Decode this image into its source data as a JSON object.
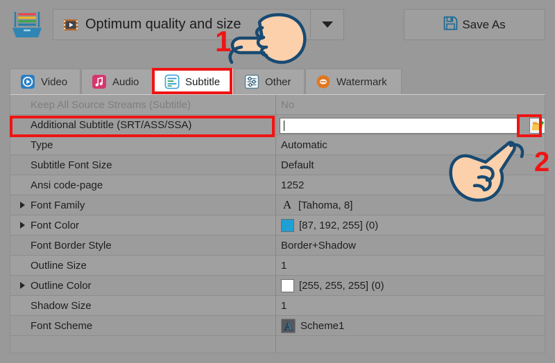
{
  "app": {
    "background_color": "#999999",
    "accent_red": "#ef1414"
  },
  "toolbar": {
    "logo_icon": "inbox-tray-icon",
    "preset": {
      "icon": "film-strip-play-icon",
      "value": "Optimum quality and size",
      "dropdown_icon": "chevron-down-icon"
    },
    "save_as": {
      "icon": "floppy-disk-save-icon",
      "label": "Save As"
    }
  },
  "tabs": [
    {
      "id": "video",
      "label": "Video",
      "icon": "video-camera-icon",
      "active": false
    },
    {
      "id": "audio",
      "label": "Audio",
      "icon": "music-note-icon",
      "active": false
    },
    {
      "id": "subtitle",
      "label": "Subtitle",
      "icon": "subtitle-lines-icon",
      "active": true
    },
    {
      "id": "other",
      "label": "Other",
      "icon": "sliders-icon",
      "active": false
    },
    {
      "id": "watermark",
      "label": "Watermark",
      "icon": "watermark-badge-icon",
      "active": false
    }
  ],
  "properties": {
    "rows": [
      {
        "name": "Keep All Source Streams (Subtitle)",
        "value": "No",
        "disabled": true,
        "expandable": false,
        "widget": "none"
      },
      {
        "name": "Additional Subtitle (SRT/ASS/SSA)",
        "value": "",
        "disabled": false,
        "expandable": false,
        "widget": "editor",
        "placeholder": ""
      },
      {
        "name": "Type",
        "value": "Automatic",
        "disabled": false,
        "expandable": false,
        "widget": "none"
      },
      {
        "name": "Subtitle Font Size",
        "value": "Default",
        "disabled": false,
        "expandable": false,
        "widget": "none"
      },
      {
        "name": "Ansi code-page",
        "value": "1252",
        "disabled": false,
        "expandable": false,
        "widget": "none"
      },
      {
        "name": "Font Family",
        "value": "[Tahoma, 8]",
        "disabled": false,
        "expandable": true,
        "widget": "font-A-icon"
      },
      {
        "name": "Font Color",
        "value": "[87, 192, 255] (0)",
        "disabled": false,
        "expandable": true,
        "widget": "swatch",
        "swatch_color": "#1f9fd4"
      },
      {
        "name": "Font Border Style",
        "value": "Border+Shadow",
        "disabled": false,
        "expandable": false,
        "widget": "none"
      },
      {
        "name": "Outline Size",
        "value": "1",
        "disabled": false,
        "expandable": false,
        "widget": "none"
      },
      {
        "name": "Outline Color",
        "value": "[255, 255, 255] (0)",
        "disabled": false,
        "expandable": true,
        "widget": "swatch",
        "swatch_color": "#ffffff"
      },
      {
        "name": "Shadow Size",
        "value": "1",
        "disabled": false,
        "expandable": false,
        "widget": "none"
      },
      {
        "name": "Font Scheme",
        "value": "Scheme1",
        "disabled": false,
        "expandable": false,
        "widget": "scheme-icon"
      }
    ],
    "browse_button_icon": "open-folder-import-icon"
  },
  "annotations": {
    "step_one": "1",
    "step_two": "2",
    "cursor_one": "pointing-hand-cursor",
    "cursor_two": "pointing-hand-cursor"
  }
}
